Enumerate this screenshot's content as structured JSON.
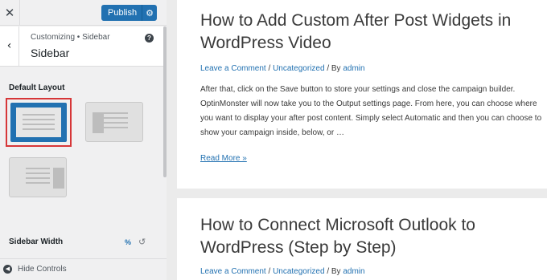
{
  "toolbar": {
    "close_icon": "close-icon",
    "publish_label": "Publish",
    "publish_settings_icon": "gear-icon",
    "accent_color": "#2271b1"
  },
  "panel_header": {
    "breadcrumb": "Customizing • Sidebar",
    "title": "Sidebar",
    "back_icon": "chevron-left-icon",
    "help_icon": "help-icon"
  },
  "default_layout": {
    "label": "Default Layout",
    "options": [
      {
        "name": "no-sidebar",
        "selected": true
      },
      {
        "name": "right-sidebar",
        "selected": false
      },
      {
        "name": "left-sidebar",
        "selected": false
      }
    ],
    "selection_highlight_color": "#d63638"
  },
  "sidebar_width": {
    "label": "Sidebar Width",
    "unit": "%",
    "reset_icon": "reset-icon"
  },
  "footer": {
    "hide_controls_label": "Hide Controls",
    "hide_icon": "collapse-icon"
  },
  "preview": {
    "articles": [
      {
        "title": "How to Add Custom After Post Widgets in WordPress Video",
        "meta_comment": "Leave a Comment",
        "meta_sep1": " / ",
        "meta_category": "Uncategorized",
        "meta_sep2": " / By ",
        "meta_author": "admin",
        "excerpt": "After that, click on the Save button to store your settings and close the campaign builder. OptinMonster will now take you to the Output settings page. From here, you can choose where you want to display your after post content. Simply select Automatic and then you can choose to show your campaign inside, below, or …",
        "read_more": "Read More »"
      },
      {
        "title": "How to Connect Microsoft Outlook to WordPress (Step by Step)",
        "meta_comment": "Leave a Comment",
        "meta_sep1": " / ",
        "meta_category": "Uncategorized",
        "meta_sep2": " / By ",
        "meta_author": "admin"
      }
    ]
  }
}
